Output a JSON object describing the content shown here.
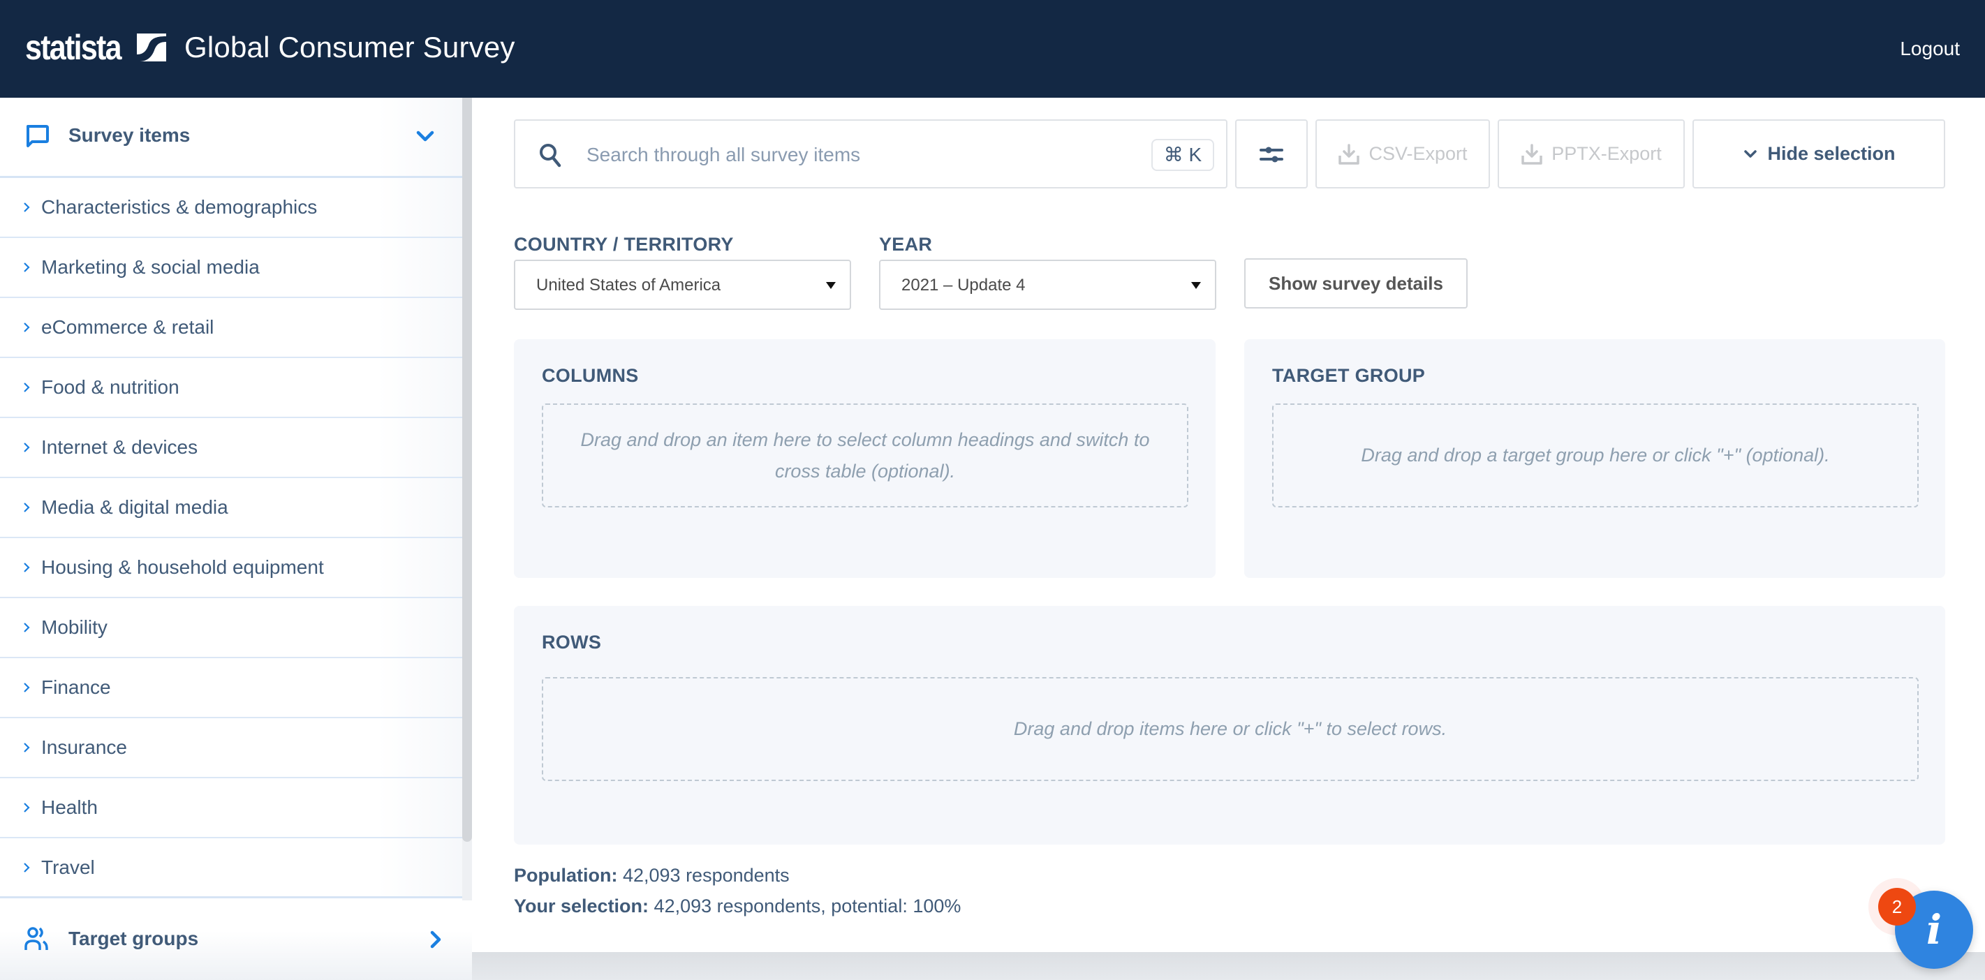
{
  "header": {
    "logo_text": "statista",
    "app_title": "Global Consumer Survey",
    "logout_label": "Logout"
  },
  "sidebar": {
    "section_title": "Survey items",
    "items": [
      {
        "label": "Characteristics & demographics"
      },
      {
        "label": "Marketing & social media"
      },
      {
        "label": "eCommerce & retail"
      },
      {
        "label": "Food & nutrition"
      },
      {
        "label": "Internet & devices"
      },
      {
        "label": "Media & digital media"
      },
      {
        "label": "Housing & household equipment"
      },
      {
        "label": "Mobility"
      },
      {
        "label": "Finance"
      },
      {
        "label": "Insurance"
      },
      {
        "label": "Health"
      },
      {
        "label": "Travel"
      }
    ],
    "footer_title": "Target groups"
  },
  "toolbar": {
    "search_placeholder": "Search through all survey items",
    "search_value": "",
    "shortcut": "⌘ K",
    "csv_export_label": "CSV-Export",
    "pptx_export_label": "PPTX-Export",
    "hide_selection_label": "Hide selection"
  },
  "filters": {
    "country_label": "COUNTRY / TERRITORY",
    "country_value": "United States of America",
    "year_label": "YEAR",
    "year_value": "2021 – Update 4",
    "details_label": "Show survey details"
  },
  "panels": {
    "columns": {
      "title": "COLUMNS",
      "hint": "Drag and drop an item here to select column headings and switch to cross table (optional)."
    },
    "target_group": {
      "title": "TARGET GROUP",
      "hint": "Drag and drop a target group here or click \"+\" (optional)."
    },
    "rows": {
      "title": "ROWS",
      "hint": "Drag and drop items here or click \"+\" to select rows."
    }
  },
  "stats": {
    "population_label": "Population:",
    "population_value": " 42,093 respondents",
    "selection_label": "Your selection:",
    "selection_value": " 42,093 respondents, potential: 100%"
  },
  "info": {
    "badge_count": "2",
    "icon_glyph": "i"
  },
  "colors": {
    "header_bg": "#132844",
    "accent": "#1a7fe0",
    "text": "#405a78",
    "badge": "#ee4811",
    "fab": "#2f84e0"
  }
}
